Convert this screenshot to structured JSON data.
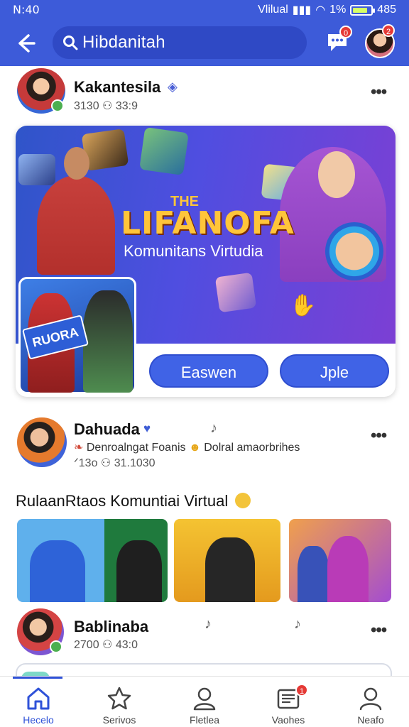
{
  "status": {
    "time": "N:40",
    "carrier": "Vlilual",
    "battery_pct": "1%",
    "right_num": "485"
  },
  "header": {
    "search_text": "Hibdanitah",
    "chat_badge": "0",
    "avatar_badge": "2"
  },
  "posts": [
    {
      "name": "Kakantesila",
      "meta": "3130 ⚇ 33:9"
    },
    {
      "name": "Dahuada",
      "subtitle": "Denroalngat Foanis",
      "subtitle2": "Dolral amaorbrihes",
      "meta": "ᐟ13o ⚇ 31.1030"
    },
    {
      "name": "Bablinaba",
      "meta": "2700 ⚇ 43:0"
    }
  ],
  "banner": {
    "title": "LIFANOFA",
    "title_top": "THE",
    "subtitle": "Komunitans Virtudia",
    "inset_text": "RUORA"
  },
  "buttons": {
    "left": "Easwen",
    "right": "Jple"
  },
  "section": {
    "title": "RulaanRtaos Komuntiai Virtual"
  },
  "nav": {
    "items": [
      {
        "label": "Hecelo"
      },
      {
        "label": "Serivos"
      },
      {
        "label": "Fletlea"
      },
      {
        "label": "Vaohes"
      },
      {
        "label": "Neafo"
      }
    ],
    "badge": "1"
  },
  "colors": {
    "brand": "#3d5bd9",
    "accent_button": "#4063e6",
    "badge": "#e53935",
    "title_gold": "#ffc53a"
  }
}
